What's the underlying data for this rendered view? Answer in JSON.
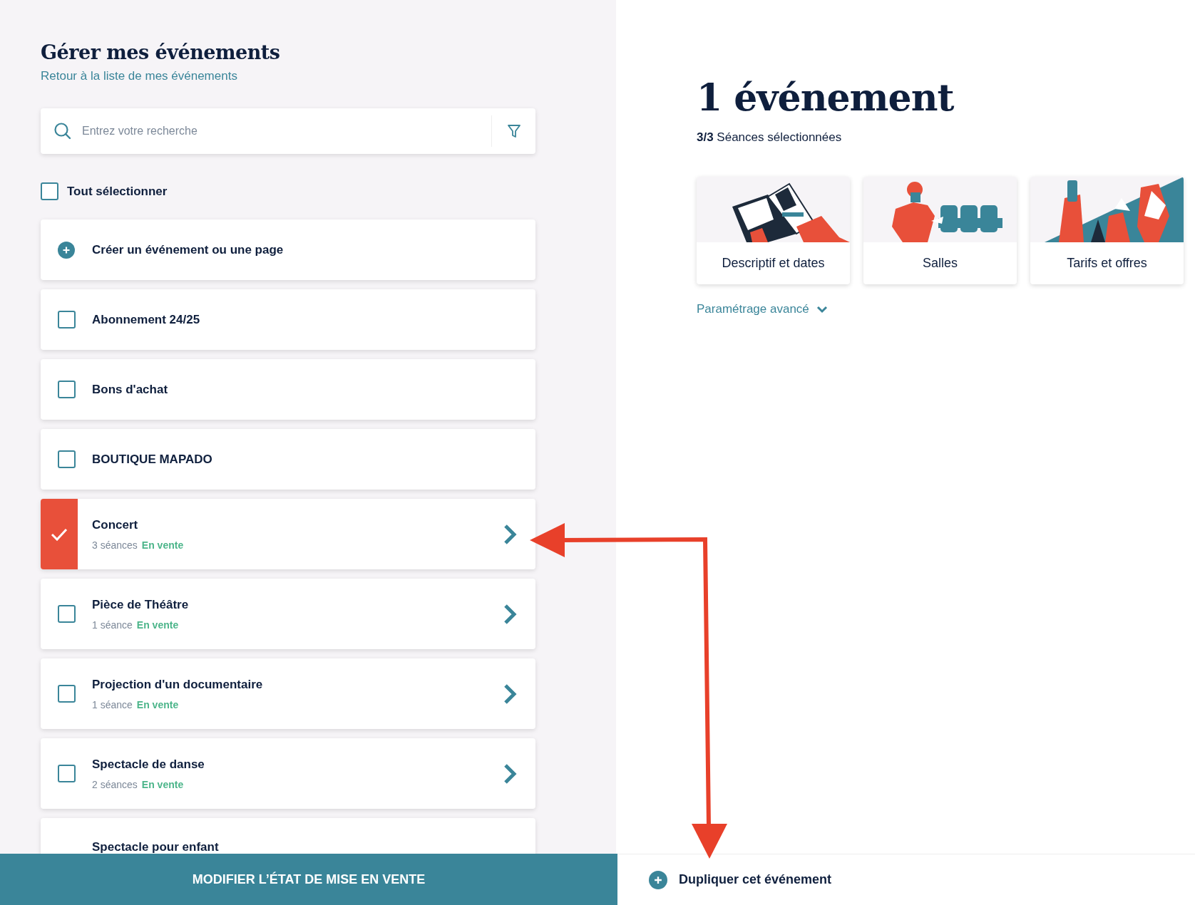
{
  "left": {
    "title": "Gérer mes événements",
    "back_link": "Retour à la liste de mes événements",
    "search": {
      "placeholder": "Entrez votre recherche"
    },
    "select_all": {
      "label": "Tout sélectionner",
      "checked": false
    },
    "items": [
      {
        "kind": "create",
        "title": "Créer un événement ou une page"
      },
      {
        "kind": "event",
        "title": "Abonnement 24/25",
        "selected": false
      },
      {
        "kind": "event",
        "title": "Bons d'achat",
        "selected": false
      },
      {
        "kind": "event",
        "title": "BOUTIQUE MAPADO",
        "selected": false
      },
      {
        "kind": "event",
        "title": "Concert",
        "sessions": "3 séances",
        "status": "En vente",
        "selected": true
      },
      {
        "kind": "event",
        "title": "Pièce de Théâtre",
        "sessions": "1 séance",
        "status": "En vente",
        "selected": false
      },
      {
        "kind": "event",
        "title": "Projection d'un documentaire",
        "sessions": "1 séance",
        "status": "En vente",
        "selected": false
      },
      {
        "kind": "event",
        "title": "Spectacle de danse",
        "sessions": "2 séances",
        "status": "En vente",
        "selected": false
      },
      {
        "kind": "event",
        "title": "Spectacle pour enfant"
      }
    ]
  },
  "right": {
    "title": "1 événement",
    "subtitle": "**3/3** Séances sélectionnées",
    "tiles": [
      {
        "label": "Descriptif et dates",
        "kind": "picture"
      },
      {
        "label": "Salles",
        "kind": "picture"
      },
      {
        "label": "Tarifs et offres",
        "kind": "picture"
      }
    ],
    "advanced": "Paramétrage avancé"
  },
  "footer": {
    "primary": "MODIFIER L’ÉTAT DE MISE EN VENTE",
    "secondary": "Dupliquer cet événement"
  }
}
